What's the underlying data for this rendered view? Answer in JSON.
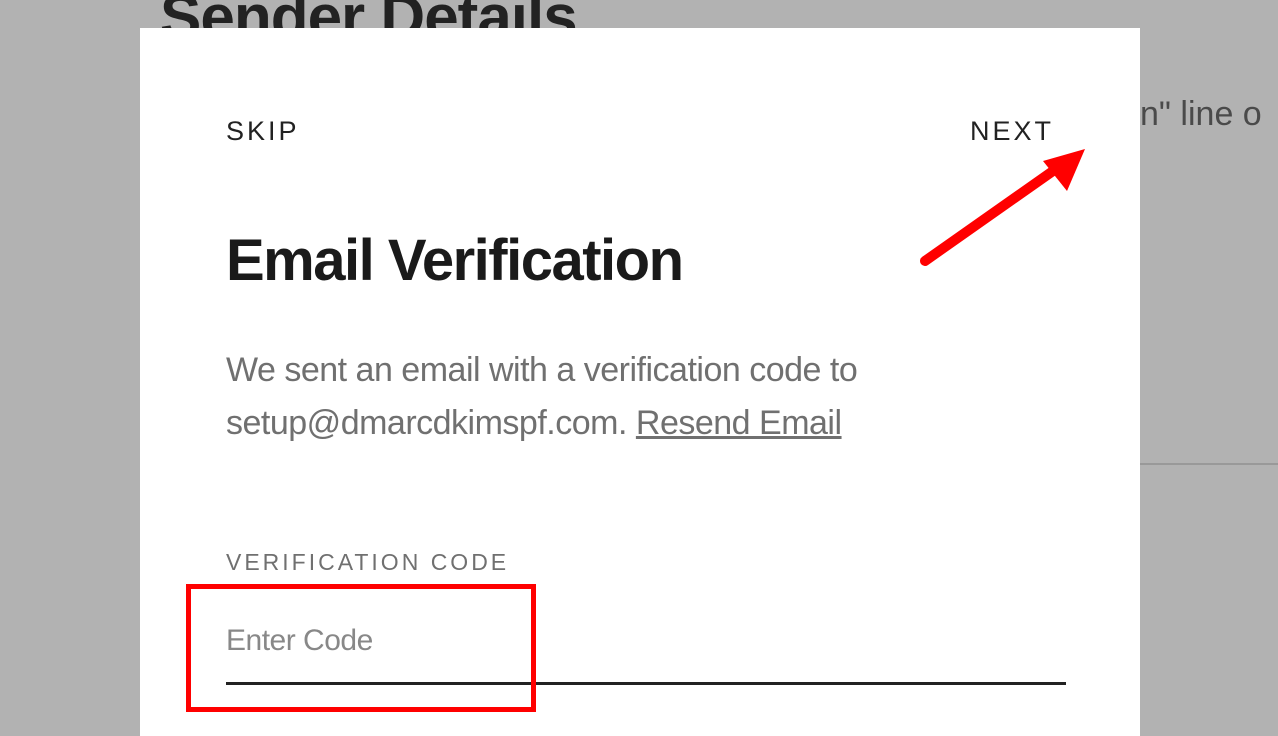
{
  "background": {
    "heading": "Sender Details",
    "right_text": "n\" line o"
  },
  "modal": {
    "nav": {
      "skip": "SKIP",
      "next": "NEXT"
    },
    "title": "Email Verification",
    "description_prefix": "We sent an email with a verification code to ",
    "email": "setup@dmarcdkimspf.com",
    "description_separator": ". ",
    "resend_label": "Resend Email",
    "field_label": "VERIFICATION CODE",
    "input_placeholder": "Enter Code",
    "input_value": ""
  }
}
